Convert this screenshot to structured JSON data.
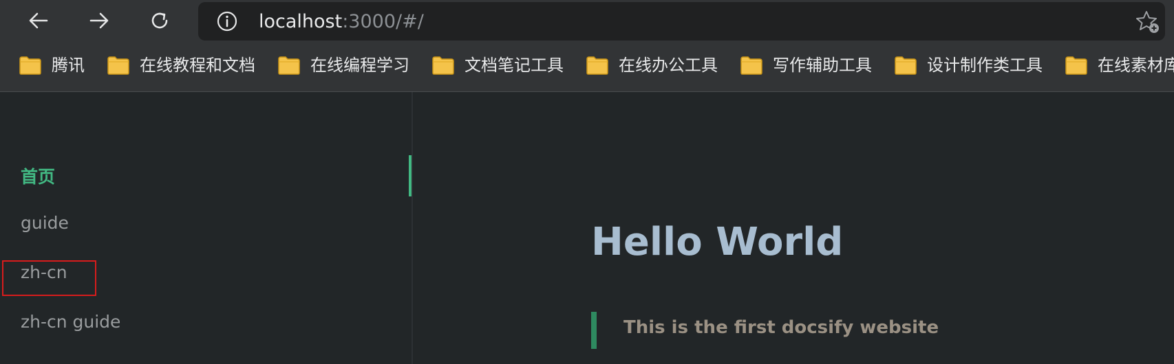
{
  "browser": {
    "address": {
      "host": "localhost",
      "path": ":3000/#/"
    },
    "nav": {
      "back_icon": "arrow-left",
      "forward_icon": "arrow-right",
      "reload_icon": "reload"
    },
    "bookmarks": [
      {
        "label": "腾讯"
      },
      {
        "label": "在线教程和文档"
      },
      {
        "label": "在线编程学习"
      },
      {
        "label": "文档笔记工具"
      },
      {
        "label": "在线办公工具"
      },
      {
        "label": "写作辅助工具"
      },
      {
        "label": "设计制作类工具"
      },
      {
        "label": "在线素材库"
      }
    ]
  },
  "sidebar": {
    "items": [
      {
        "label": "首页",
        "active": true
      },
      {
        "label": "guide"
      },
      {
        "label": "zh-cn",
        "highlighted": true
      },
      {
        "label": "zh-cn guide"
      }
    ]
  },
  "content": {
    "heading": "Hello World",
    "blockquote": "This is the first docsify website"
  },
  "colors": {
    "accent": "#42b983",
    "highlight": "#d91c1c",
    "heading": "#a8bdd0"
  }
}
